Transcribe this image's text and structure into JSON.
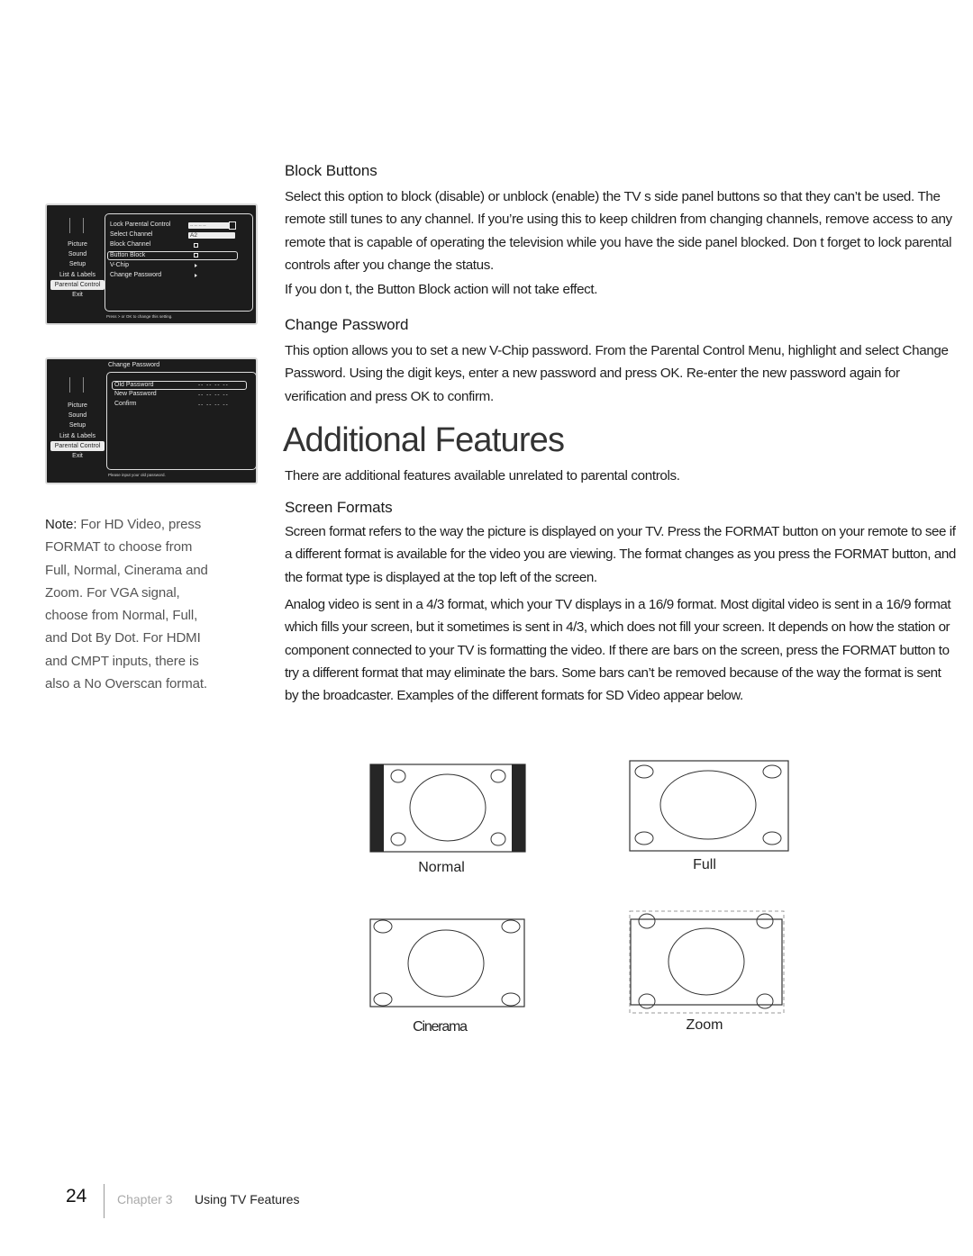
{
  "tv_menu_1": {
    "nav_items": [
      "Picture",
      "Sound",
      "Setup",
      "List & Labels",
      "Parental Control",
      "Exit"
    ],
    "selected_nav": "Parental Control",
    "rows": [
      {
        "label": "Lock Parental Control",
        "value_type": "password-lock",
        "value": "-- -- -- --"
      },
      {
        "label": "Select Channel",
        "value_type": "field",
        "value": "A2"
      },
      {
        "label": "Block Channel",
        "value_type": "checkbox",
        "value": ""
      },
      {
        "label": "Button Block",
        "value_type": "checkbox",
        "value": "",
        "highlighted": true
      },
      {
        "label": "V-Chip",
        "value_type": "arrow",
        "value": ""
      },
      {
        "label": "Change Password",
        "value_type": "arrow",
        "value": ""
      }
    ],
    "hint": "Press > or OK to change this setting."
  },
  "tv_menu_2": {
    "title": "Change Password",
    "nav_items": [
      "Picture",
      "Sound",
      "Setup",
      "List & Labels",
      "Parental Control",
      "Exit"
    ],
    "selected_nav": "Parental Control",
    "rows": [
      {
        "label": "Old Password",
        "value": "-- -- -- --",
        "highlighted": true
      },
      {
        "label": "New Password",
        "value": "-- -- -- --"
      },
      {
        "label": "Confirm",
        "value": "-- -- -- --"
      }
    ],
    "hint": "Please input your old password."
  },
  "note": {
    "label": "Note:",
    "text": " For HD Video, press FORMAT to choose from Full, Normal, Cinerama and Zoom. For VGA signal, choose from Normal, Full, and Dot By Dot. For HDMI and CMPT inputs, there is also a No Overscan format."
  },
  "block_buttons": {
    "heading": "Block Buttons",
    "paragraph1": "Select this option to block (disable) or unblock (enable) the TV s side panel buttons so that they can’t be used. The remote still tunes to any channel. If you’re using this to keep children from changing channels, remove access to any remote that is capable of operating the television while you have the side panel blocked. Don t forget to lock parental controls after you change the status.",
    "paragraph2": "If you don t, the Button Block action will not take effect."
  },
  "change_password": {
    "heading": "Change Password",
    "paragraph": "This option allows you to set a new V-Chip password. From the Parental Control Menu, highlight and select Change Password. Using the digit keys, enter a new password and press OK. Re-enter the new password again for verification and press OK to confirm."
  },
  "additional_features": {
    "title": "Additional Features",
    "intro": "There are additional features available unrelated to parental controls."
  },
  "screen_formats": {
    "heading": "Screen Formats",
    "paragraph1": "Screen format refers to the way the picture is displayed on your TV. Press the FORMAT button on your remote to see if a different format is available for the video you are viewing. The format changes as you press the FORMAT button, and the format type is displayed at the top left of the screen.",
    "paragraph2": "Analog video is sent in a 4/3 format, which your TV displays in a 16/9 format. Most digital video is sent in a 16/9 format which fills your screen, but it sometimes is sent in 4/3, which does not fill your screen. It depends on how the station or component connected to your TV is formatting the video. If there are bars on the screen, press the FORMAT button to try a different format that may eliminate the bars. Some bars can’t be removed because of the way the format is sent by the broadcaster. Examples of the different formats for SD Video appear below."
  },
  "format_figures": [
    {
      "label": "Normal"
    },
    {
      "label": "Full"
    },
    {
      "label": "Cinerama"
    },
    {
      "label": "Zoom"
    }
  ],
  "footer": {
    "page_number": "24",
    "chapter": "Chapter 3",
    "chapter_title": "Using TV Features"
  }
}
